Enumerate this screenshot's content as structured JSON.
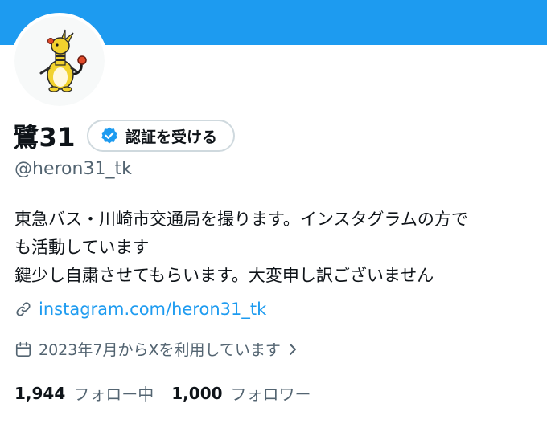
{
  "colors": {
    "banner": "#1d9bf0",
    "link": "#1d9bf0",
    "secondary_text": "#536471",
    "verified_badge": "#1d9bf0"
  },
  "profile": {
    "display_name": "鷺31",
    "verify_button_label": "認証を受ける",
    "handle": "@heron31_tk",
    "bio_lines": [
      "東急バス・川崎市交通局を撮ります。インスタグラムの方で",
      "も活動しています",
      "鍵少し自粛させてもらいます。大変申し訳ございません"
    ],
    "link_text": "instagram.com/heron31_tk",
    "joined_text": "2023年7月からXを利用しています",
    "following_count": "1,944",
    "following_label": "フォロー中",
    "followers_count": "1,000",
    "followers_label": "フォロワー"
  },
  "icons": {
    "verified": "verified-badge-icon",
    "link": "link-icon",
    "calendar": "calendar-icon",
    "chevron": "chevron-right-icon",
    "avatar": "ampharos-avatar"
  }
}
